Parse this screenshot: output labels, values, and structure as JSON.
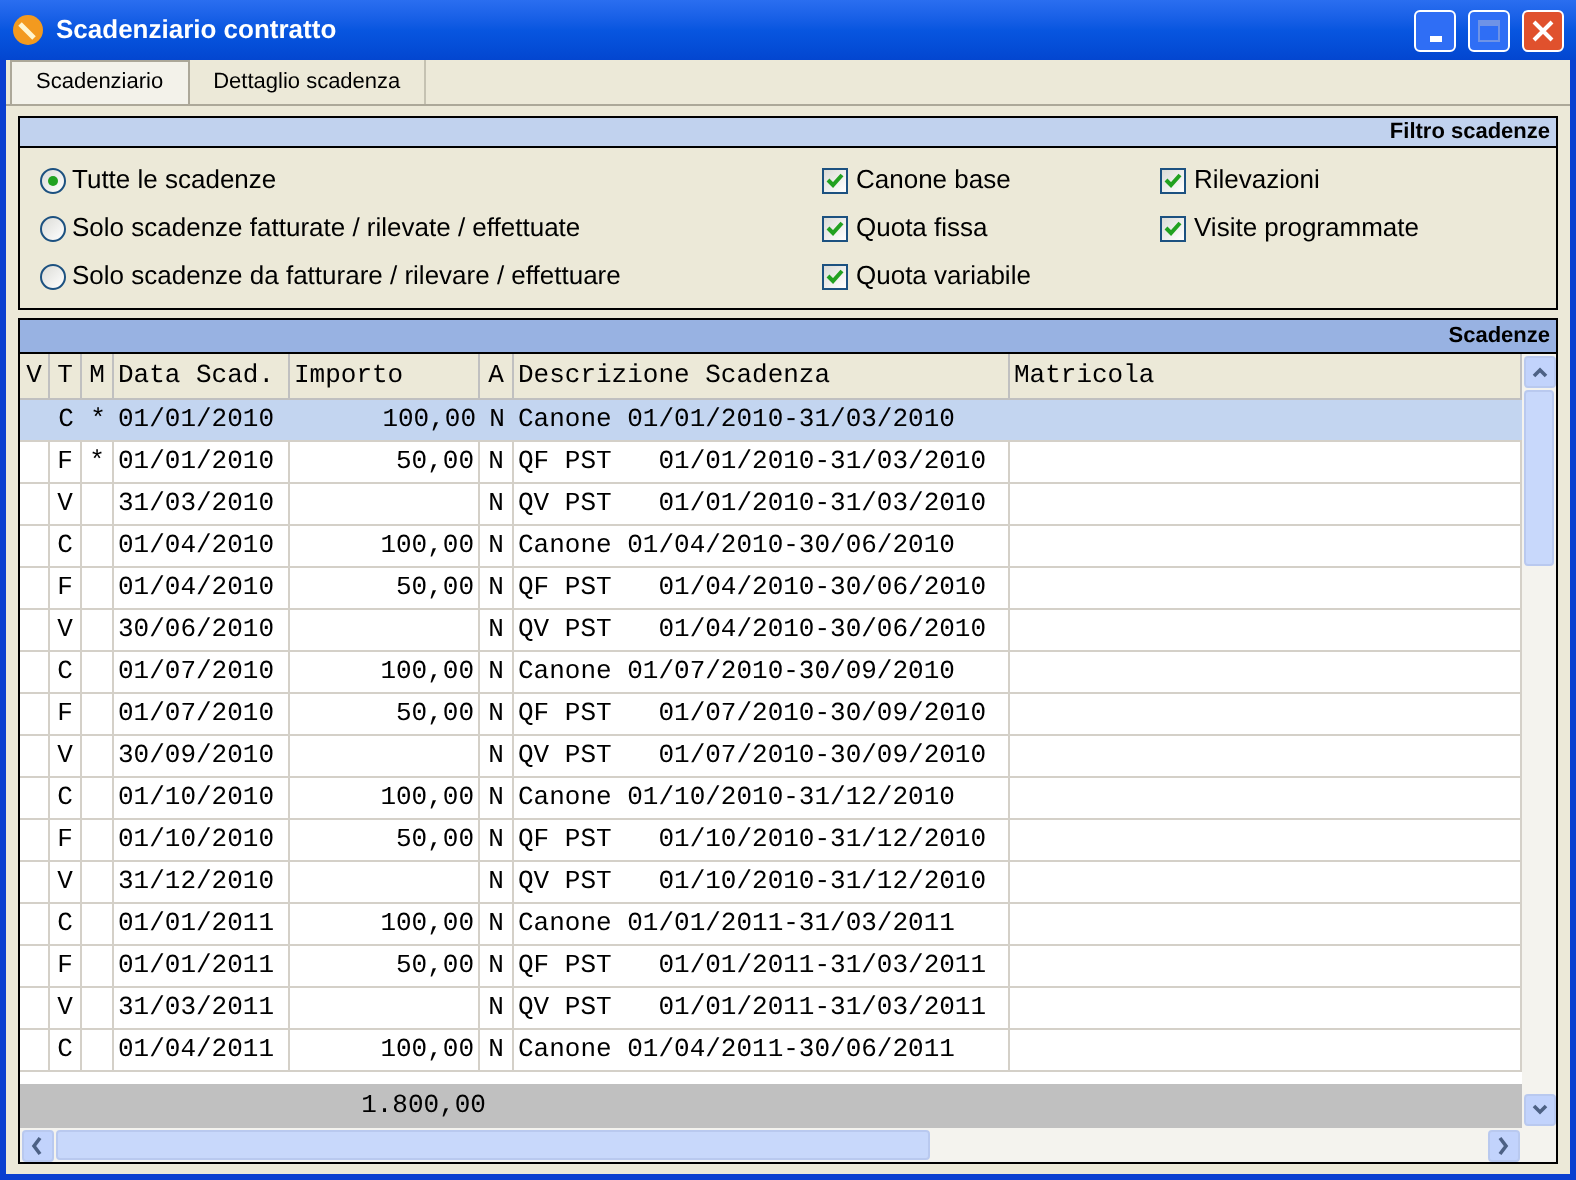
{
  "window": {
    "title": "Scadenziario contratto"
  },
  "tabs": [
    {
      "label": "Scadenziario",
      "selected": true
    },
    {
      "label": "Dettaglio scadenza",
      "selected": false
    }
  ],
  "filter": {
    "title": "Filtro scadenze",
    "radios": [
      {
        "label": "Tutte le scadenze",
        "selected": true
      },
      {
        "label": "Solo scadenze fatturate / rilevate / effettuate",
        "selected": false
      },
      {
        "label": "Solo scadenze da fatturare / rilevare / effettuare",
        "selected": false
      }
    ],
    "checks_col1": [
      {
        "label": "Canone base",
        "checked": true
      },
      {
        "label": "Quota fissa",
        "checked": true
      },
      {
        "label": "Quota variabile",
        "checked": true
      }
    ],
    "checks_col2": [
      {
        "label": "Rilevazioni",
        "checked": true
      },
      {
        "label": "Visite programmate",
        "checked": true
      }
    ]
  },
  "grid": {
    "title": "Scadenze",
    "columns": [
      "V",
      "T",
      "M",
      "Data Scad.",
      "Importo",
      "A",
      "Descrizione Scadenza",
      "Matricola"
    ],
    "rows": [
      {
        "t": "C",
        "m": "*",
        "data": "01/01/2010",
        "importo": "100,00",
        "a": "N",
        "descrizione": "Canone 01/01/2010-31/03/2010",
        "selected": true
      },
      {
        "t": "F",
        "m": "*",
        "data": "01/01/2010",
        "importo": "50,00",
        "a": "N",
        "descrizione": "QF PST   01/01/2010-31/03/2010",
        "selected": false
      },
      {
        "t": "V",
        "data": "31/03/2010",
        "a": "N",
        "descrizione": "QV PST   01/01/2010-31/03/2010",
        "selected": false
      },
      {
        "t": "C",
        "data": "01/04/2010",
        "importo": "100,00",
        "a": "N",
        "descrizione": "Canone 01/04/2010-30/06/2010",
        "selected": false
      },
      {
        "t": "F",
        "data": "01/04/2010",
        "importo": "50,00",
        "a": "N",
        "descrizione": "QF PST   01/04/2010-30/06/2010",
        "selected": false
      },
      {
        "t": "V",
        "data": "30/06/2010",
        "a": "N",
        "descrizione": "QV PST   01/04/2010-30/06/2010",
        "selected": false
      },
      {
        "t": "C",
        "data": "01/07/2010",
        "importo": "100,00",
        "a": "N",
        "descrizione": "Canone 01/07/2010-30/09/2010",
        "selected": false
      },
      {
        "t": "F",
        "data": "01/07/2010",
        "importo": "50,00",
        "a": "N",
        "descrizione": "QF PST   01/07/2010-30/09/2010",
        "selected": false
      },
      {
        "t": "V",
        "data": "30/09/2010",
        "a": "N",
        "descrizione": "QV PST   01/07/2010-30/09/2010",
        "selected": false
      },
      {
        "t": "C",
        "data": "01/10/2010",
        "importo": "100,00",
        "a": "N",
        "descrizione": "Canone 01/10/2010-31/12/2010",
        "selected": false
      },
      {
        "t": "F",
        "data": "01/10/2010",
        "importo": "50,00",
        "a": "N",
        "descrizione": "QF PST   01/10/2010-31/12/2010",
        "selected": false
      },
      {
        "t": "V",
        "data": "31/12/2010",
        "a": "N",
        "descrizione": "QV PST   01/10/2010-31/12/2010",
        "selected": false
      },
      {
        "t": "C",
        "data": "01/01/2011",
        "importo": "100,00",
        "a": "N",
        "descrizione": "Canone 01/01/2011-31/03/2011",
        "selected": false
      },
      {
        "t": "F",
        "data": "01/01/2011",
        "importo": "50,00",
        "a": "N",
        "descrizione": "QF PST   01/01/2011-31/03/2011",
        "selected": false
      },
      {
        "t": "V",
        "data": "31/03/2011",
        "a": "N",
        "descrizione": "QV PST   01/01/2011-31/03/2011",
        "selected": false
      },
      {
        "t": "C",
        "data": "01/04/2011",
        "importo": "100,00",
        "a": "N",
        "descrizione": "Canone 01/04/2011-30/06/2011",
        "selected": false
      }
    ],
    "total": "1.800,00"
  }
}
